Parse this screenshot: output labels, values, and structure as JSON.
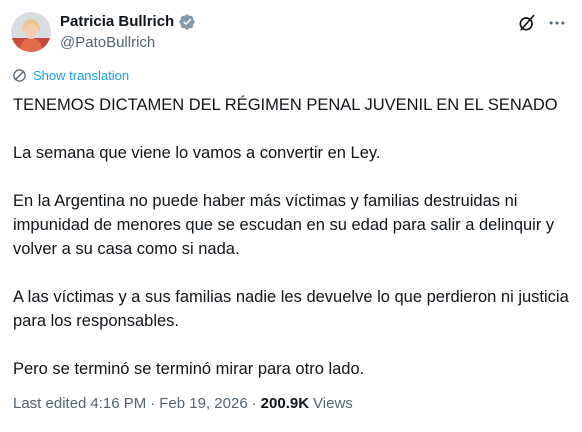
{
  "author": {
    "display_name": "Patricia Bullrich",
    "handle": "@PatoBullrich",
    "verified_icon": "verified-badge-icon"
  },
  "actions": {
    "grok_icon": "grok-icon",
    "more_icon": "more-options-icon"
  },
  "translation": {
    "label": "Show translation",
    "icon": "translate-icon"
  },
  "post": {
    "paragraphs": [
      "TENEMOS DICTAMEN DEL RÉGIMEN PENAL JUVENIL EN EL SENADO",
      "La semana que viene lo vamos a convertir en Ley.",
      "En la Argentina no puede haber más víctimas y familias destruidas ni impunidad de menores que se escudan en su edad para salir a delinquir y volver a su casa como si nada.",
      "A las víctimas y a sus familias nadie les devuelve lo que perdieron ni justicia para los responsables.",
      "Pero se terminó se terminó mirar para otro lado."
    ]
  },
  "meta": {
    "edited_label": "Last edited",
    "time": "4:16 PM",
    "separator": "·",
    "date": "Feb 19, 2026",
    "views_count": "200.9K",
    "views_label": "Views"
  },
  "colors": {
    "text": "#0f1419",
    "secondary": "#536471",
    "link": "#1d9bf0",
    "verified": "#829aab"
  }
}
